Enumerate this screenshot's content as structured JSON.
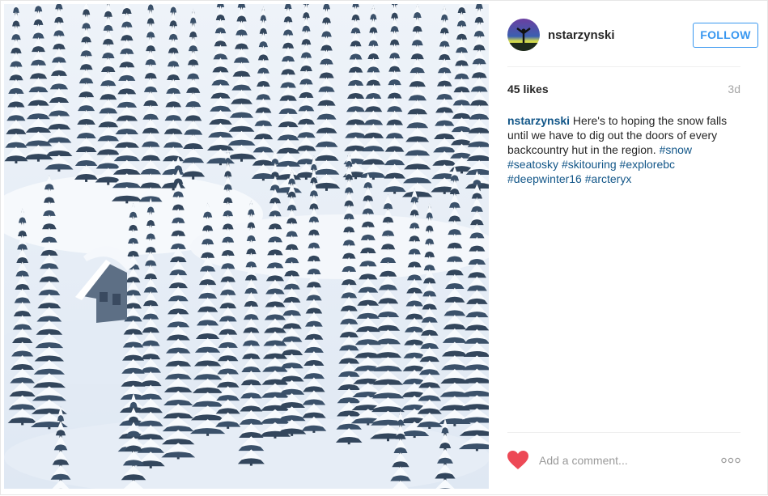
{
  "post": {
    "photo_alt": "",
    "header": {
      "username": "nstarzynski",
      "follow_label": "FOLLOW"
    },
    "likes": "45 likes",
    "time_ago": "3d",
    "caption": {
      "username": "nstarzynski",
      "text": " Here's to hoping the snow falls until we have to dig out the doors of every backcountry hut in the region. ",
      "hashtags": [
        "#snow",
        "#seatosky",
        "#skitouring",
        "#explorebc",
        "#deepwinter16",
        "#arcteryx"
      ]
    },
    "comment_placeholder": "Add a comment...",
    "icons": {
      "like": "heart-icon",
      "more": "more-options-icon"
    },
    "colors": {
      "accent": "#3897f0",
      "link": "#125688",
      "heart": "#ed4956"
    }
  }
}
